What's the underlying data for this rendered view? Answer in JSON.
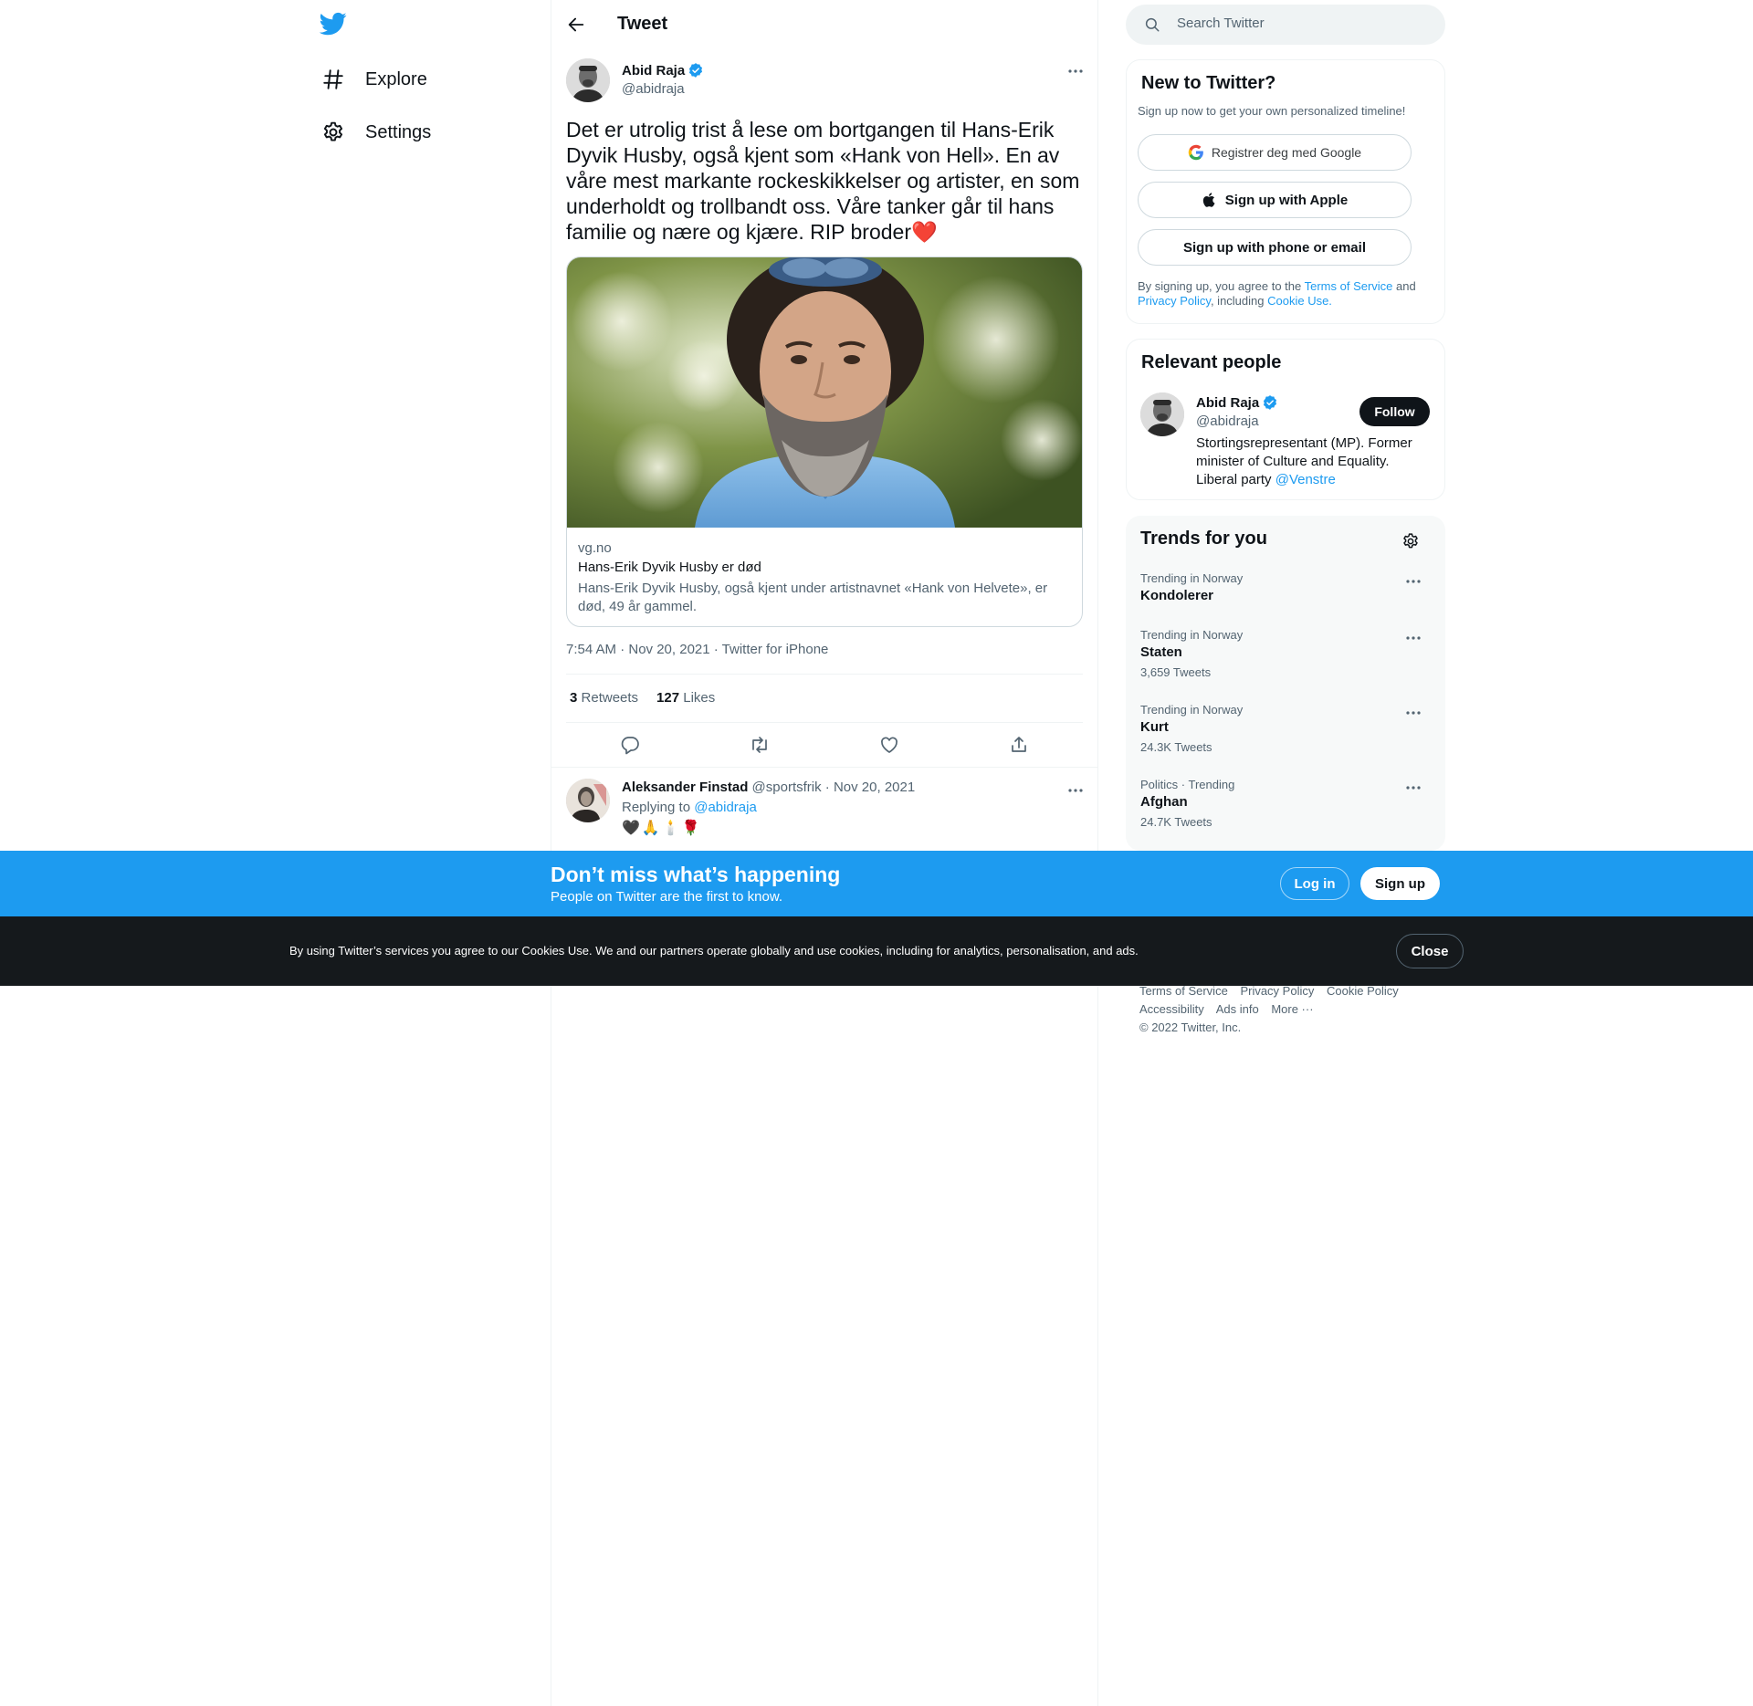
{
  "nav": {
    "logo": "twitter-bird-icon",
    "items": [
      {
        "label": "Explore",
        "icon": "hashtag-icon"
      },
      {
        "label": "Settings",
        "icon": "gear-icon"
      }
    ]
  },
  "header": {
    "title": "Tweet"
  },
  "tweet": {
    "author_name": "Abid Raja",
    "author_handle": "@abidraja",
    "text": "Det er utrolig trist å lese om bortgangen til Hans-Erik Dyvik Husby, også kjent som «Hank von Hell». En av våre mest markante rockeskikkelser og artister, en som underholdt og trollbandt oss. Våre tanker går til hans familie og nære og kjære. RIP broder",
    "text_emoji": "❤️",
    "card": {
      "domain": "vg.no",
      "title": "Hans-Erik Dyvik Husby er død",
      "description": "Hans-Erik Dyvik Husby, også kjent under artistnavnet «Hank von Helvete», er død, 49 år gammel."
    },
    "time": "7:54 AM · Nov 20, 2021 · ",
    "source": "Twitter for iPhone",
    "retweets_count": "3",
    "retweets_label": "Retweets",
    "likes_count": "127",
    "likes_label": "Likes"
  },
  "reply": {
    "name": "Aleksander Finstad",
    "meta": " @sportsfrik · Nov 20, 2021",
    "replying_label": "Replying to ",
    "replying_to": "@abidraja",
    "emojis": [
      "🖤",
      "🙏",
      "🕯️",
      "🌹"
    ]
  },
  "search": {
    "placeholder": "Search Twitter"
  },
  "new_to_twitter": {
    "title": "New to Twitter?",
    "subtitle": "Sign up now to get your own personalized timeline!",
    "google_label": "Registrer deg med Google",
    "apple_label": "Sign up with Apple",
    "phone_label": "Sign up with phone or email",
    "legal_1": "By signing up, you agree to the ",
    "legal_terms": "Terms of Service",
    "legal_2": " and ",
    "legal_privacy": "Privacy Policy",
    "legal_3": ", including ",
    "legal_cookie": "Cookie Use."
  },
  "relevant_people": {
    "title": "Relevant people",
    "name": "Abid Raja",
    "handle": "@abidraja",
    "follow_label": "Follow",
    "bio": "Stortingsrepresentant (MP). Former minister of Culture and Equality. Liberal party ",
    "bio_link": "@Venstre"
  },
  "trends": {
    "title": "Trends for you",
    "items": [
      {
        "context": "Trending in Norway",
        "name": "Kondolerer",
        "count": ""
      },
      {
        "context": "Trending in Norway",
        "name": "Staten",
        "count": "3,659 Tweets"
      },
      {
        "context": "Trending in Norway",
        "name": "Kurt",
        "count": "24.3K Tweets"
      },
      {
        "context": "Politics · Trending",
        "name": "Afghan",
        "count": "24.7K Tweets"
      }
    ]
  },
  "footer": {
    "links_row1": [
      "Terms of Service",
      "Privacy Policy",
      "Cookie Policy"
    ],
    "links_row2": [
      "Accessibility",
      "Ads info",
      "More ···"
    ],
    "copyright": "© 2022 Twitter, Inc."
  },
  "banner": {
    "title": "Don’t miss what’s happening",
    "subtitle": "People on Twitter are the first to know.",
    "login_label": "Log in",
    "signup_label": "Sign up"
  },
  "cookie_bar": {
    "text": "By using Twitter’s services you agree to our Cookies Use. We and our partners operate globally and use cookies, including for analytics, personalisation, and ads.",
    "close_label": "Close"
  },
  "colors": {
    "brand_blue": "#1d9bf0",
    "text_primary": "#0f1419",
    "text_secondary": "#536471",
    "cookie_bar_bg": "#15191c"
  }
}
